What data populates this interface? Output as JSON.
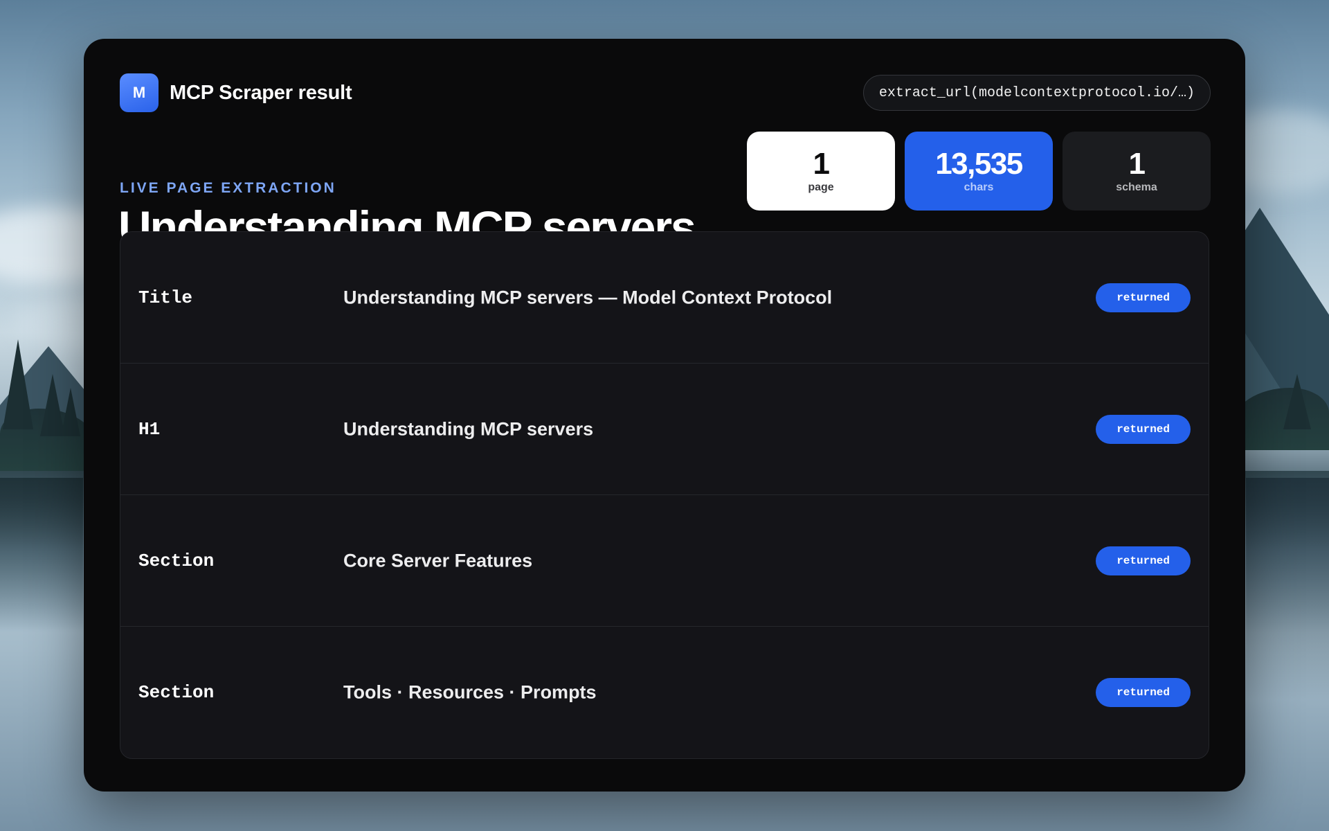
{
  "app": {
    "title": "MCP Scraper result",
    "logo_letter": "M",
    "call": "extract_url(modelcontextprotocol.io/…)"
  },
  "header": {
    "eyebrow": "LIVE PAGE EXTRACTION",
    "title": "Understanding MCP servers"
  },
  "stats": [
    {
      "value": "1",
      "label": "page"
    },
    {
      "value": "13,535",
      "label": "chars"
    },
    {
      "value": "1",
      "label": "schema"
    }
  ],
  "rows": [
    {
      "key": "Title",
      "value": "Understanding MCP servers — Model Context Protocol",
      "status": "returned"
    },
    {
      "key": "H1",
      "value": "Understanding MCP servers",
      "status": "returned"
    },
    {
      "key": "Section",
      "value": "Core Server Features",
      "status": "returned"
    },
    {
      "key": "Section",
      "value": "Tools · Resources · Prompts",
      "status": "returned"
    }
  ],
  "colors": {
    "accent": "#2460ea",
    "card_background": "#0a0a0b",
    "eyebrow": "#7ea6f5"
  }
}
